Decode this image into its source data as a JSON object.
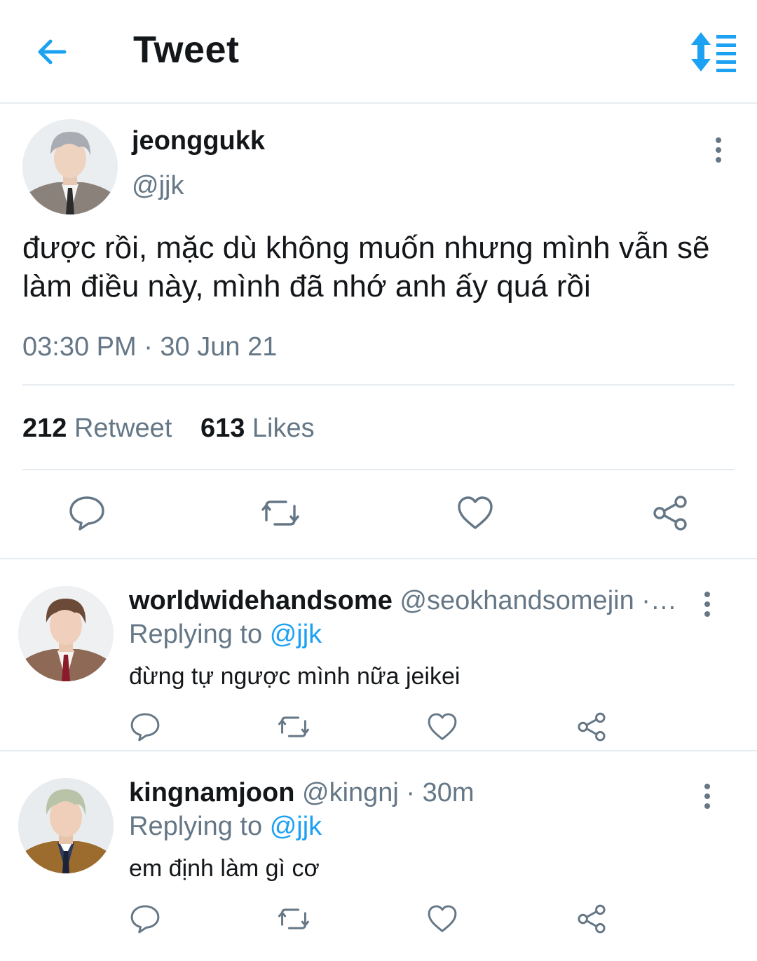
{
  "header": {
    "title": "Tweet",
    "back_icon": "arrow-left-icon",
    "sort_icon": "sort-icon",
    "accent": "#1da1f2"
  },
  "tweet": {
    "display_name": "jeonggukk",
    "handle": "@jjk",
    "text": "được rồi, mặc dù không muốn nhưng mình vẫn sẽ làm điều này, mình đã nhớ anh ấy quá rồi",
    "timestamp": "03:30 PM · 30 Jun 21",
    "retweet_count": "212",
    "retweet_label": "Retweet",
    "likes_count": "613",
    "likes_label": "Likes"
  },
  "replies": [
    {
      "display_name": "worldwidehandsome",
      "meta": "@seokhandsomejin ·…",
      "replying_label": "Replying to",
      "mention": "@jjk",
      "text": "đừng tự ngược mình nữa jeikei"
    },
    {
      "display_name": "kingnamjoon",
      "meta": "@kingnj · 30m",
      "replying_label": "Replying to",
      "mention": "@jjk",
      "text": "em định làm gì cơ"
    }
  ],
  "icons": [
    "reply-icon",
    "retweet-icon",
    "like-icon",
    "share-icon",
    "more-icon"
  ]
}
